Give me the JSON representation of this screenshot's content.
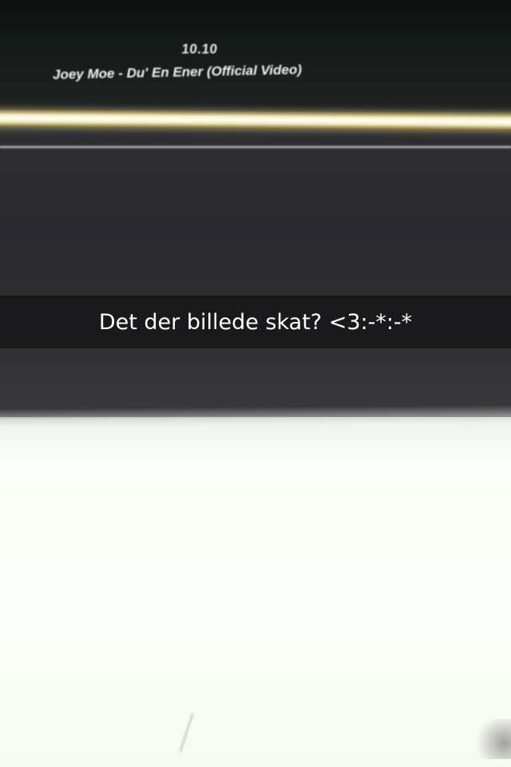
{
  "video_screen": {
    "time_label": "10.10",
    "video_title": "Joey Moe - Du' En Ener (Official Video)",
    "progress_fraction": 1.0
  },
  "caption": {
    "text": "Det der billede skat? <3:-*:-*"
  }
}
